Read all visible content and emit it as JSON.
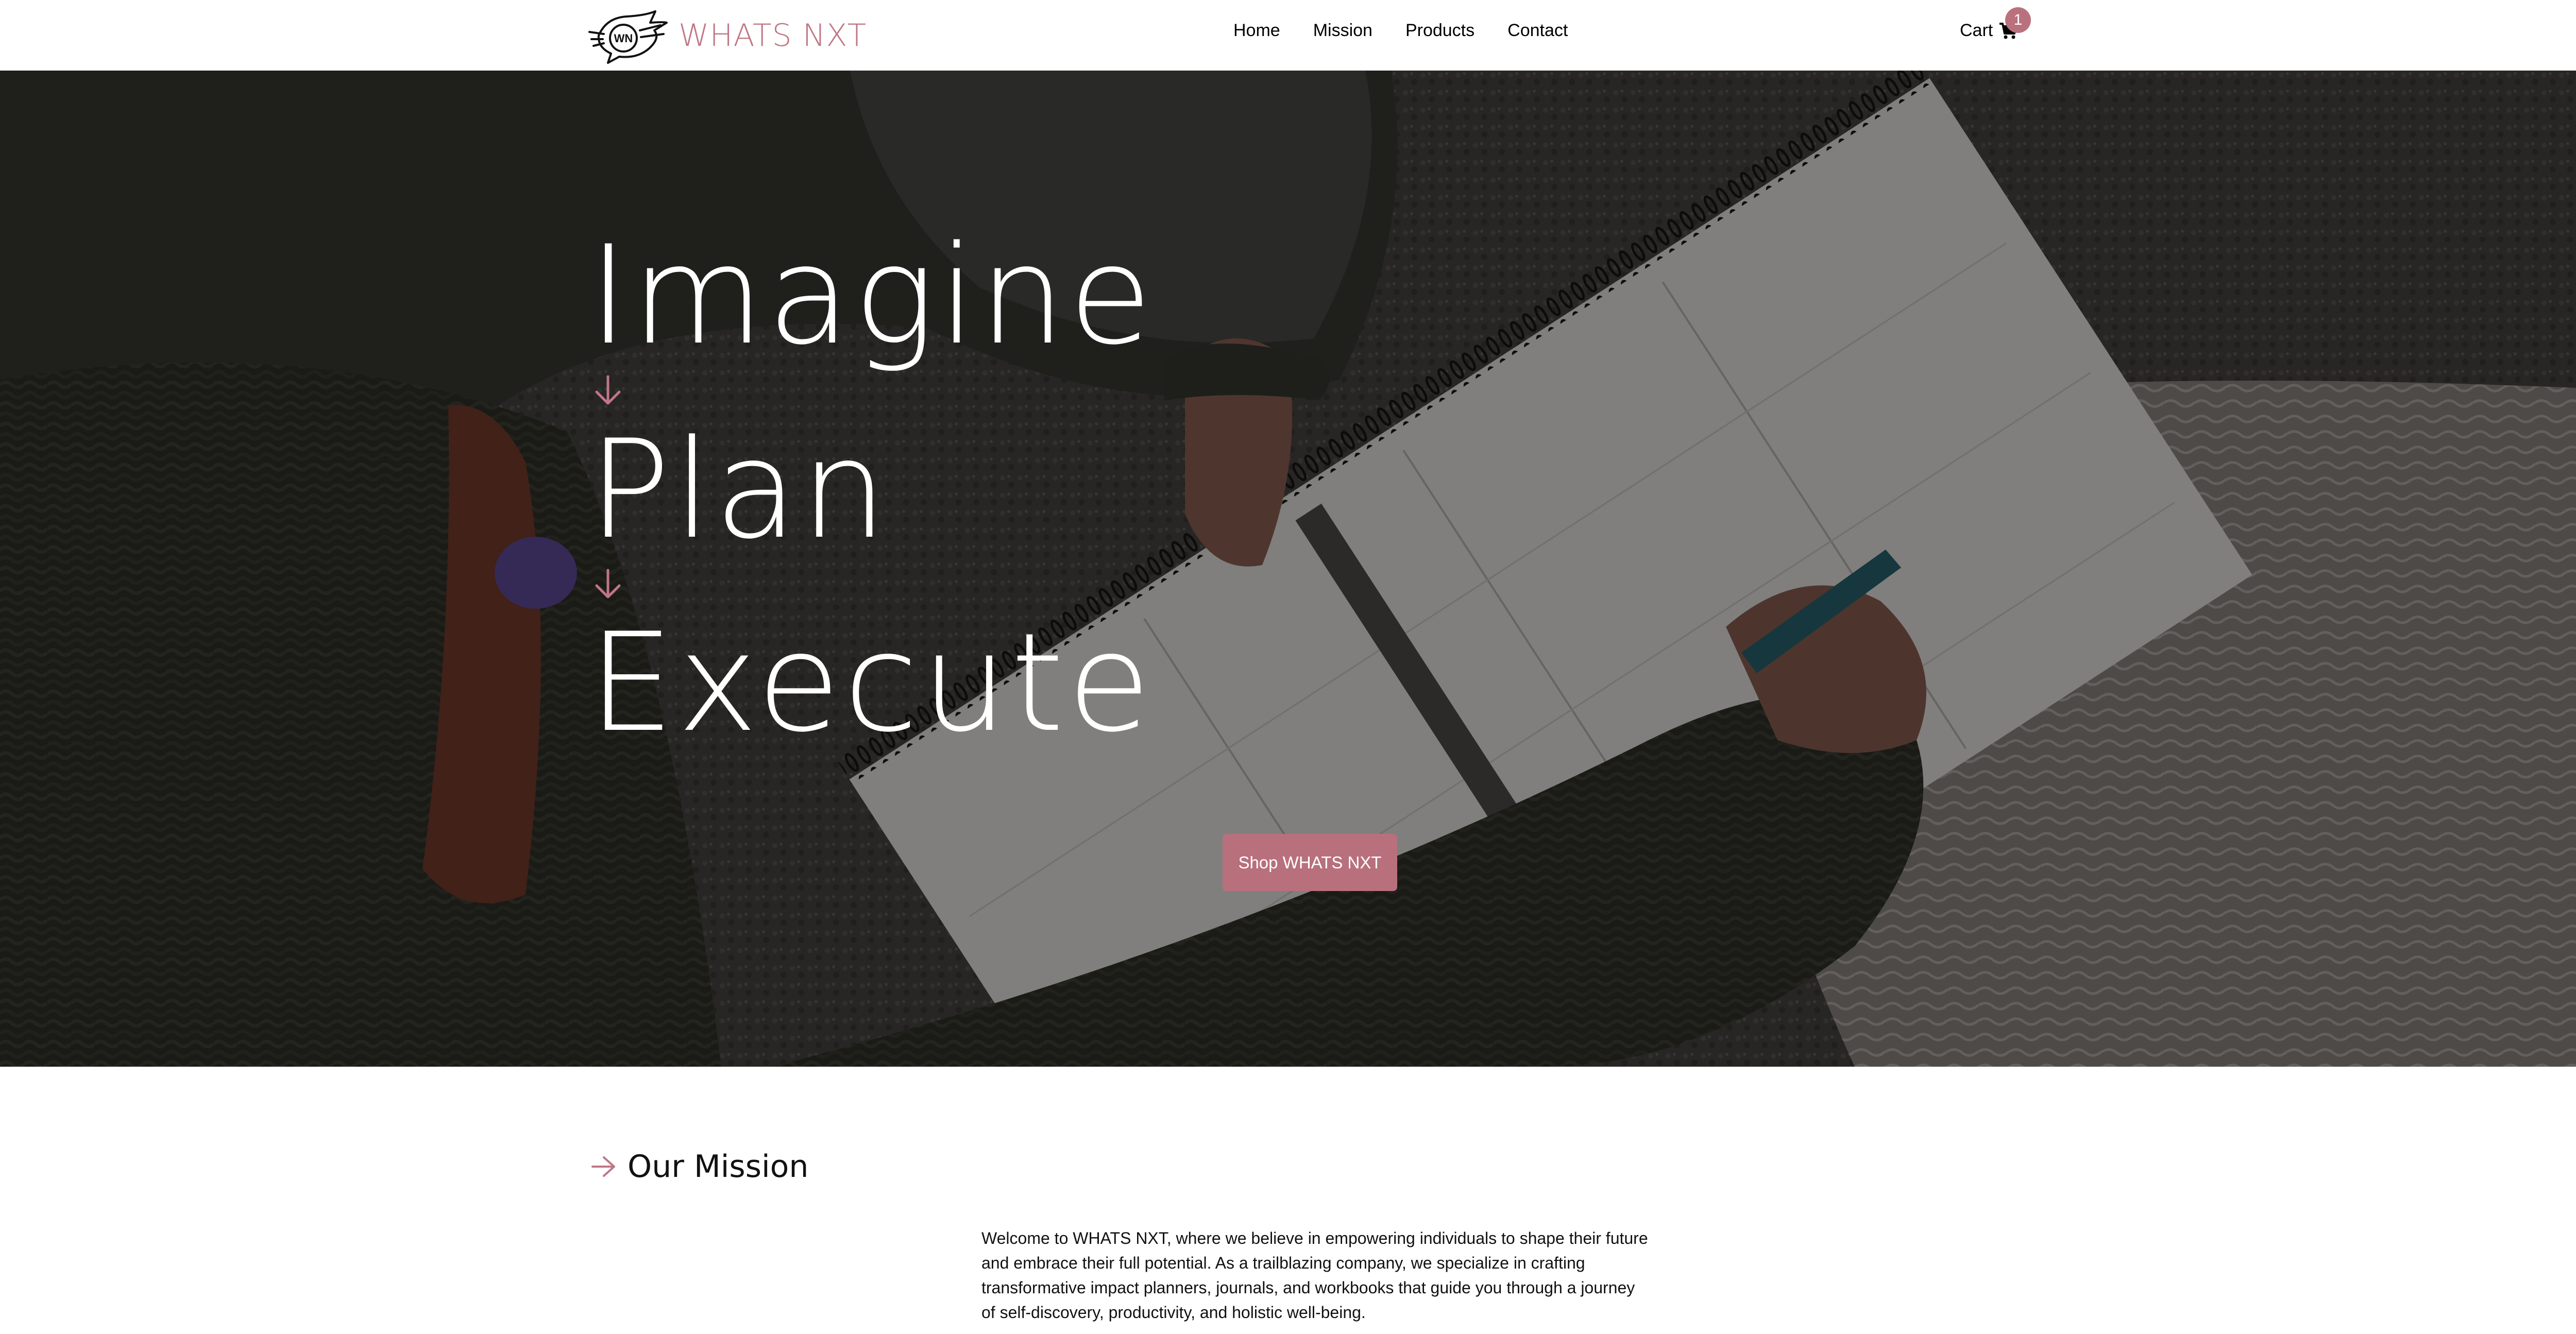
{
  "brand": {
    "name": "WHATS NXT",
    "logo_text": "WN",
    "color": "#c07685"
  },
  "nav": {
    "links": [
      "Home",
      "Mission",
      "Products",
      "Contact"
    ]
  },
  "cart": {
    "label": "Cart",
    "count": "1",
    "icon": "shopping-cart-icon",
    "badge_color": "#b9727d"
  },
  "hero": {
    "words": [
      "Imagine",
      "Plan",
      "Execute"
    ],
    "arrow_icon": "arrow-down-icon",
    "cta_label": "Shop WHATS NXT",
    "accent_color": "#b8707c"
  },
  "mission": {
    "title": "Our Mission",
    "arrow_icon": "arrow-right-icon",
    "text": "Welcome to WHATS NXT, where we believe in empowering individuals to shape their future and embrace their full potential. As a trailblazing company, we specialize in crafting transformative impact planners, journals, and workbooks that guide you through a journey of self-discovery, productivity, and holistic well-being."
  }
}
